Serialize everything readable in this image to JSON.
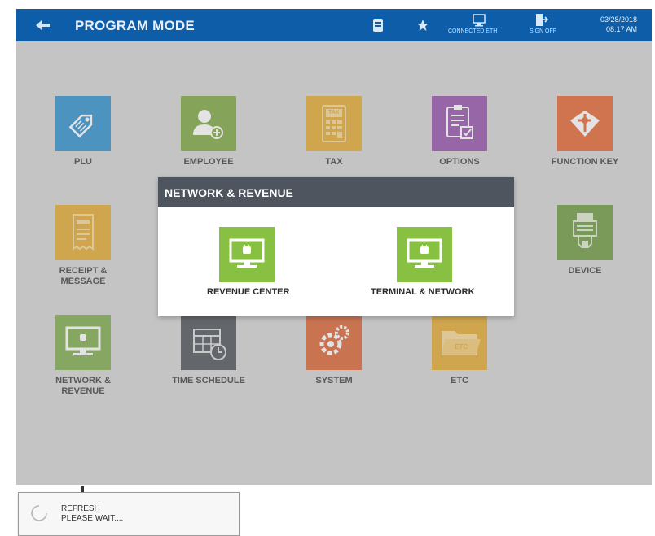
{
  "header": {
    "title": "PROGRAM MODE",
    "connection_label": "CONNECTED ETH",
    "signoff_label": "SIGN OFF",
    "date": "03/28/2018",
    "time": "08:17 AM"
  },
  "menu": {
    "plu": "PLU",
    "employee": "EMPLOYEE",
    "tax": "TAX",
    "tax_icon_text": "TAX",
    "options": "OPTIONS",
    "function_key": "FUNCTION KEY",
    "receipt_line1": "RECEIPT &",
    "receipt_line2": "MESSAGE",
    "device": "DEVICE",
    "network_line1": "NETWORK &",
    "network_line2": "REVENUE",
    "time_schedule": "TIME SCHEDULE",
    "system": "SYSTEM",
    "etc": "ETC",
    "etc_icon_text": "ETC"
  },
  "modal": {
    "title": "NETWORK & REVENUE",
    "revenue_center": "REVENUE CENTER",
    "terminal_network": "TERMINAL & NETWORK"
  },
  "refresh": {
    "line1": "REFRESH",
    "line2": "PLEASE WAIT...."
  },
  "colors": {
    "topbar": "#0d5da8",
    "plu": "#1a84c8",
    "employee": "#6f9f2c",
    "tax": "#e0a21a",
    "options": "#8b3fa1",
    "function_key": "#e0551c",
    "receipt": "#e0a21a",
    "device": "#5f8f2b",
    "network": "#6fa33a",
    "time_schedule": "#3b3f45",
    "system": "#d9541e",
    "etc": "#e0a21a",
    "modal_tile": "#88c041",
    "modal_header": "#4f555f"
  }
}
